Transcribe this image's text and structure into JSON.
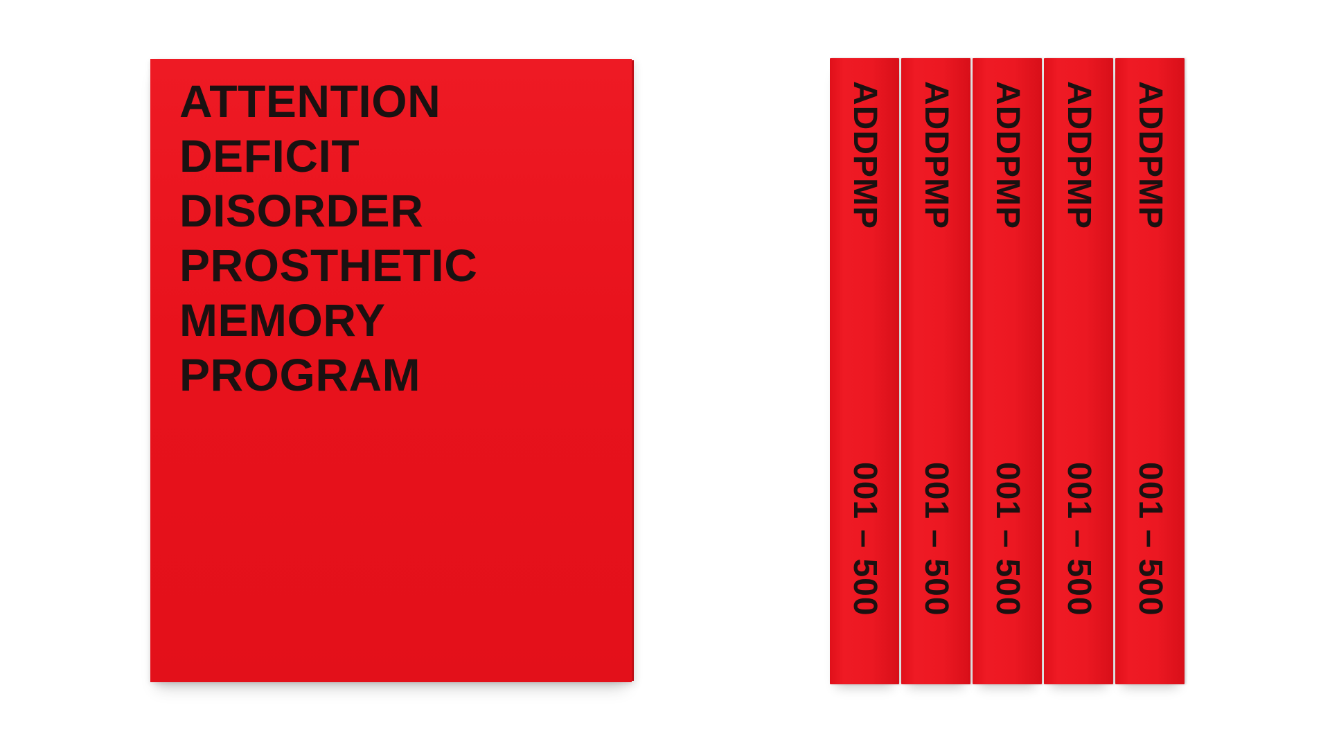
{
  "cover": {
    "title_lines": [
      "ATTENTION",
      "DEFICIT",
      "DISORDER",
      "PROSTHETIC",
      "MEMORY",
      "PROGRAM"
    ],
    "color": "#e8121c"
  },
  "spines": [
    {
      "title": "ADDPMP",
      "range": "001 – 500"
    },
    {
      "title": "ADDPMP",
      "range": "001 – 500"
    },
    {
      "title": "ADDPMP",
      "range": "001 – 500"
    },
    {
      "title": "ADDPMP",
      "range": "001 – 500"
    },
    {
      "title": "ADDPMP",
      "range": "001 – 500"
    }
  ],
  "colors": {
    "background": "#ffffff",
    "book_red": "#e8121c",
    "ink": "#1a1111"
  }
}
